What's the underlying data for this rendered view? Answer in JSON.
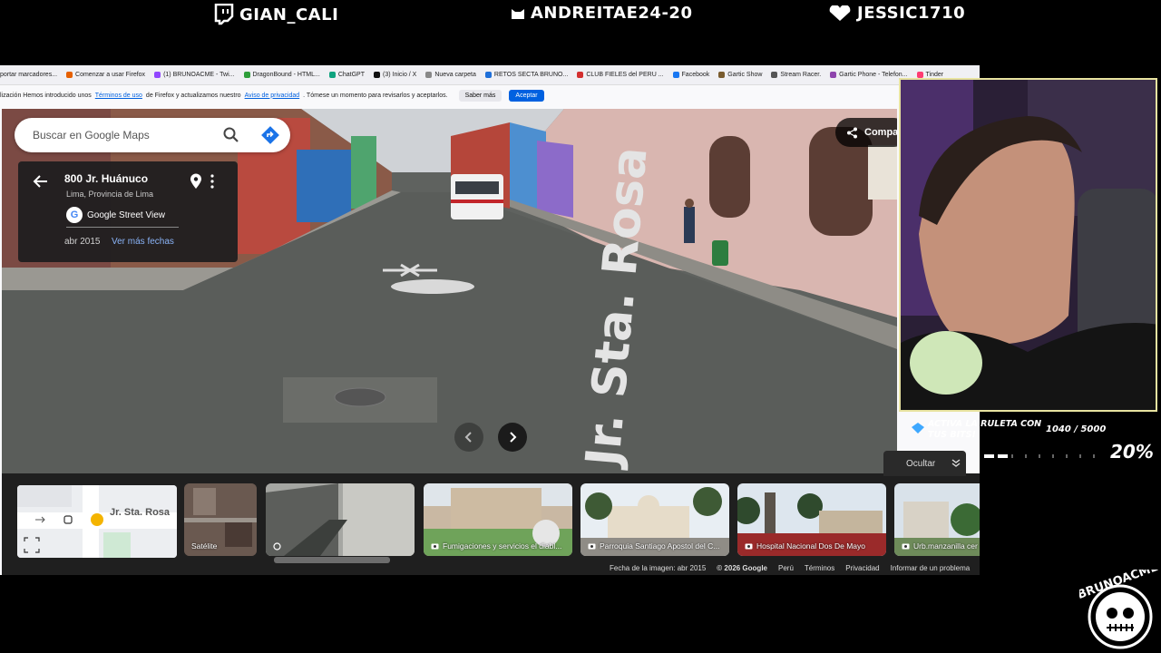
{
  "stream": {
    "top_names": [
      {
        "icon": "twitch-icon",
        "label": "GIAN_CALI"
      },
      {
        "icon": "cat-icon",
        "label": "ANDREITAE24-20"
      },
      {
        "icon": "heart-icon",
        "label": "JESSIC1710"
      }
    ],
    "roulette": {
      "line1": "ACTIVA LA RULETA CON",
      "line2": "TUS BITS!"
    },
    "bits": "1040 / 5000",
    "percent_label": "20%",
    "progress_fraction": 0.2,
    "logo_text": "BRUNOACME"
  },
  "browser": {
    "bookmarks": [
      {
        "label": "portar marcadores...",
        "color": "#ffffff"
      },
      {
        "label": "Comenzar a usar Firefox",
        "color": "#e66000"
      },
      {
        "label": "(1) BRUNOACME - Twi...",
        "color": "#9146ff"
      },
      {
        "label": "DragonBound - HTML...",
        "color": "#2e9e3a"
      },
      {
        "label": "ChatGPT",
        "color": "#10a37f"
      },
      {
        "label": "(3) Inicio / X",
        "color": "#111111"
      },
      {
        "label": "Nueva carpeta",
        "color": "#888888"
      },
      {
        "label": "RETOS SECTA BRUNO...",
        "color": "#1e6fd9"
      },
      {
        "label": "CLUB FIELES del PERU ...",
        "color": "#d32f2f"
      },
      {
        "label": "Facebook",
        "color": "#1877f2"
      },
      {
        "label": "Gartic Show",
        "color": "#7a5c2e"
      },
      {
        "label": "Stream Racer.",
        "color": "#555555"
      },
      {
        "label": "Gartic Phone - Telefon...",
        "color": "#8e44ad"
      },
      {
        "label": "Tinder",
        "color": "#fe3c72"
      }
    ],
    "notice": {
      "prefix": "lización Hemos introducido unos",
      "link1": "Términos de uso",
      "middle": "de Firefox y actualizamos nuestro",
      "link2": "Aviso de privacidad",
      "suffix": ". Tómese un momento para revisarlos y aceptarlos.",
      "learn_more": "Saber más",
      "accept": "Aceptar"
    }
  },
  "maps": {
    "search_placeholder": "Buscar en Google Maps",
    "place_title": "800 Jr. Huánuco",
    "place_sub": "Lima, Provincia de Lima",
    "street_view_label": "Google Street View",
    "date": "abr 2015",
    "more_dates": "Ver más fechas",
    "share": "Compa",
    "street_name": "Jr. Sta. Rosa",
    "hide": "Ocultar",
    "thumbs": [
      {
        "label": "Satélite",
        "icon": ""
      },
      {
        "label": "",
        "icon": "streetview-icon"
      },
      {
        "label": "Fumigaciones y servicios el diabl...",
        "icon": "camera-icon"
      },
      {
        "label": "Parroquia Santiago Apostol del C...",
        "icon": "camera-icon"
      },
      {
        "label": "Hospital Nacional Dos De Mayo",
        "icon": "camera-icon"
      },
      {
        "label": "Urb.manzanilla cer",
        "icon": "camera-icon"
      }
    ],
    "footer": {
      "image_date": "Fecha de la imagen: abr 2015",
      "copyright": "© 2026 Google",
      "country": "Perú",
      "terms": "Términos",
      "privacy": "Privacidad",
      "report": "Informar de un problema"
    }
  }
}
